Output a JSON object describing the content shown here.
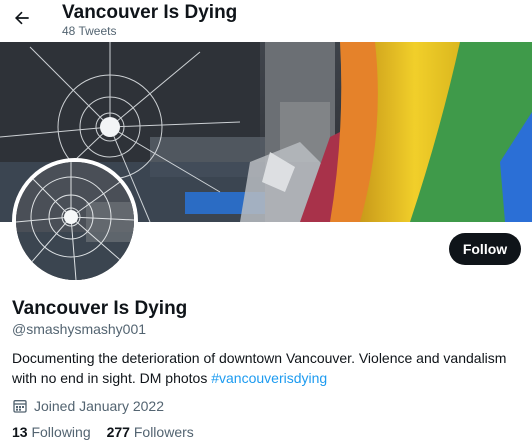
{
  "header": {
    "back_icon": "arrow-left-icon",
    "title": "Vancouver Is Dying",
    "tweet_count": "48 Tweets"
  },
  "profile": {
    "name": "Vancouver Is Dying",
    "handle": "@smashysmashy001",
    "bio_text": "Documenting the deterioration of downtown Vancouver. Violence and vandalism with no end in sight. DM photos ",
    "bio_hashtag": "#vancouverisdying",
    "joined_icon": "calendar-icon",
    "joined": "Joined January 2022",
    "follow_label": "Follow"
  },
  "stats": {
    "following_count": "13",
    "following_label": "Following",
    "followers_count": "277",
    "followers_label": "Followers"
  },
  "colors": {
    "link": "#1d9bf0",
    "primary_text": "#0f1419",
    "secondary_text": "#536471",
    "button_bg": "#0f1419"
  }
}
